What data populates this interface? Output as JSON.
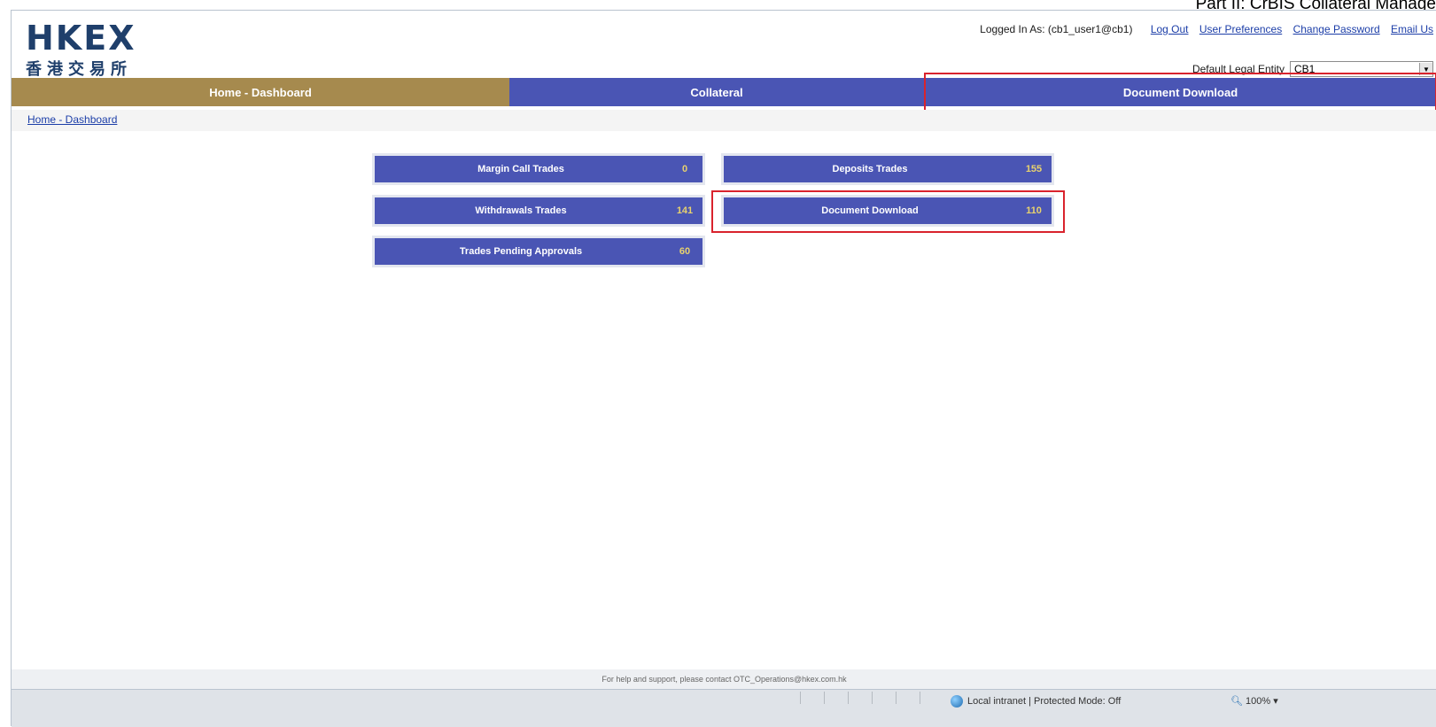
{
  "doc_title": "Part II: CrBIS Collateral Manage",
  "logo": {
    "text": "HKEX",
    "chinese": "香港交易所"
  },
  "header": {
    "logged_in_label": "Logged In As: (cb1_user1@cb1)",
    "links": {
      "logout": "Log Out",
      "preferences": "User Preferences",
      "change_password": "Change Password",
      "email": "Email Us"
    },
    "entity_label": "Default Legal Entity",
    "entity_value": "CB1"
  },
  "nav": {
    "home": "Home - Dashboard",
    "collateral": "Collateral",
    "document": "Document Download"
  },
  "breadcrumb": "Home - Dashboard",
  "tiles": {
    "margin_call": {
      "label": "Margin Call Trades",
      "count": "0"
    },
    "deposits": {
      "label": "Deposits Trades",
      "count": "155"
    },
    "withdrawals": {
      "label": "Withdrawals Trades",
      "count": "141"
    },
    "document": {
      "label": "Document Download",
      "count": "110"
    },
    "pending": {
      "label": "Trades Pending Approvals",
      "count": "60"
    }
  },
  "footer": "For help and support, please contact OTC_Operations@hkex.com.hk",
  "statusbar": {
    "zone": "Local intranet | Protected Mode: Off",
    "zoom": "100%"
  },
  "colors": {
    "nav_active": "#a68a4e",
    "nav_tab": "#4a55b4",
    "highlight": "#d9232d"
  }
}
